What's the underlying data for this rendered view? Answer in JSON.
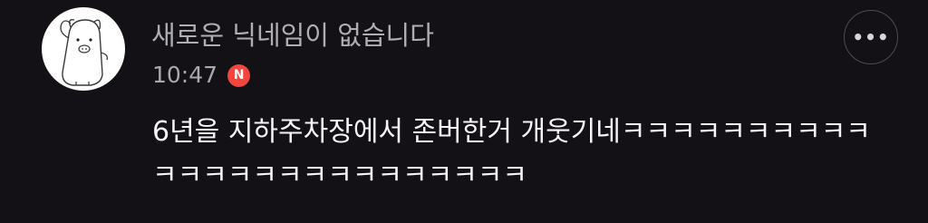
{
  "post": {
    "author_name": "새로운 닉네임이 없습니다",
    "timestamp": "10:47",
    "badge": "N",
    "more_label": "•••",
    "body": "6년을 지하주차장에서 존버한거 개웃기네ㅋㅋㅋㅋㅋㅋㅋㅋㅋㅋㅋㅋㅋㅋㅋㅋㅋㅋㅋㅋㅋㅋㅋㅋㅋ"
  },
  "colors": {
    "background": "#131116",
    "author": "#aeaeb4",
    "body": "#f5f5f7",
    "badge": "#f0463c"
  },
  "icons": {
    "avatar": "pig-character-avatar",
    "more": "more-options-icon",
    "badge": "new-badge-icon"
  }
}
